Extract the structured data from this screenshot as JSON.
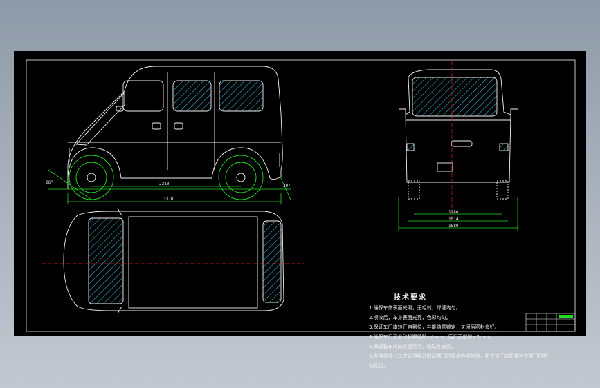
{
  "drawing": {
    "dimensions": {
      "wheelbase": "2310",
      "overall_length": "3370",
      "approach_angle": "26°",
      "departure_angle": "30°",
      "rear_track": "1280",
      "track": "1514",
      "overall_width": "1580"
    },
    "technical_requirements": {
      "title": "技术要求",
      "items": [
        "1.确保车体表面光滑，无毛刺，焊缝均匀。",
        "2.喷漆后，车身表面光亮，色彩均匀。",
        "3.保证车门旋转开启到位，并能随意锁定，关闭后密封良好。",
        "4.确保车门及发动机罩缝隙≤4mm，后门面缝隙≤3mm。",
        "5.保证整车转向轻便灵活，制动性良好。",
        "6.各部件或分总成必须经过制动部门的技术检测检验，将有该厂的质量检查部门的检",
        "验标记。"
      ]
    }
  },
  "colors": {
    "line": "#f2f2f2",
    "centerline": "#e02020",
    "wheel": "#22dd22",
    "hatch": "#2bb8d8",
    "dimension": "#22dd22"
  }
}
